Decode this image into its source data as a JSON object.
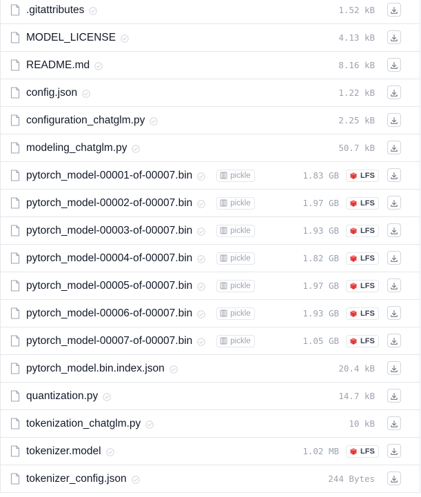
{
  "files": [
    {
      "name": ".gitattributes",
      "size": "1.52 kB",
      "pickle": false,
      "lfs": false
    },
    {
      "name": "MODEL_LICENSE",
      "size": "4.13 kB",
      "pickle": false,
      "lfs": false
    },
    {
      "name": "README.md",
      "size": "8.16 kB",
      "pickle": false,
      "lfs": false
    },
    {
      "name": "config.json",
      "size": "1.22 kB",
      "pickle": false,
      "lfs": false
    },
    {
      "name": "configuration_chatglm.py",
      "size": "2.25 kB",
      "pickle": false,
      "lfs": false
    },
    {
      "name": "modeling_chatglm.py",
      "size": "50.7 kB",
      "pickle": false,
      "lfs": false
    },
    {
      "name": "pytorch_model-00001-of-00007.bin",
      "size": "1.83 GB",
      "pickle": true,
      "lfs": true
    },
    {
      "name": "pytorch_model-00002-of-00007.bin",
      "size": "1.97 GB",
      "pickle": true,
      "lfs": true
    },
    {
      "name": "pytorch_model-00003-of-00007.bin",
      "size": "1.93 GB",
      "pickle": true,
      "lfs": true
    },
    {
      "name": "pytorch_model-00004-of-00007.bin",
      "size": "1.82 GB",
      "pickle": true,
      "lfs": true
    },
    {
      "name": "pytorch_model-00005-of-00007.bin",
      "size": "1.97 GB",
      "pickle": true,
      "lfs": true
    },
    {
      "name": "pytorch_model-00006-of-00007.bin",
      "size": "1.93 GB",
      "pickle": true,
      "lfs": true
    },
    {
      "name": "pytorch_model-00007-of-00007.bin",
      "size": "1.05 GB",
      "pickle": true,
      "lfs": true
    },
    {
      "name": "pytorch_model.bin.index.json",
      "size": "20.4 kB",
      "pickle": false,
      "lfs": false
    },
    {
      "name": "quantization.py",
      "size": "14.7 kB",
      "pickle": false,
      "lfs": false
    },
    {
      "name": "tokenization_chatglm.py",
      "size": "10 kB",
      "pickle": false,
      "lfs": false
    },
    {
      "name": "tokenizer.model",
      "size": "1.02 MB",
      "pickle": false,
      "lfs": true
    },
    {
      "name": "tokenizer_config.json",
      "size": "244 Bytes",
      "pickle": false,
      "lfs": false
    }
  ],
  "labels": {
    "pickle": "pickle",
    "lfs": "LFS"
  },
  "icons": {
    "file": "file-icon",
    "safe": "shield-check-icon",
    "pickle": "pickle-icon",
    "lfs": "lfs-icon",
    "download": "download-icon"
  },
  "colors": {
    "border": "#e5e7eb",
    "text": "#111827",
    "muted": "#9ca3af",
    "lfs_red": "#dc2626"
  }
}
